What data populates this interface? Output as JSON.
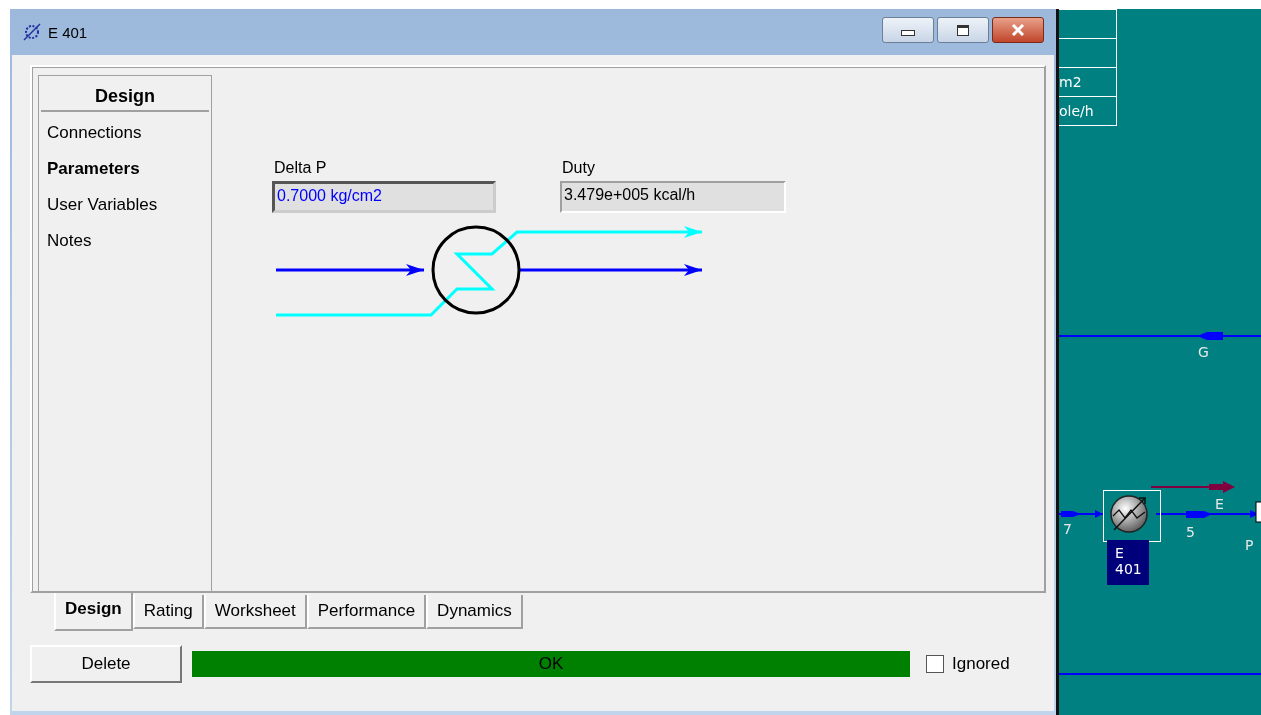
{
  "window": {
    "title": "E 401"
  },
  "sidebar": {
    "header": "Design",
    "items": [
      {
        "label": "Connections",
        "selected": false
      },
      {
        "label": "Parameters",
        "selected": true
      },
      {
        "label": "User Variables",
        "selected": false
      },
      {
        "label": "Notes",
        "selected": false
      }
    ]
  },
  "parameters": [
    {
      "label": "Delta P",
      "value": "0.7000 kg/cm2",
      "kind": "specified"
    },
    {
      "label": "Duty",
      "value": "3.479e+005 kcal/h",
      "kind": "calculated"
    }
  ],
  "tabs": [
    {
      "label": "Design",
      "selected": true
    },
    {
      "label": "Rating",
      "selected": false
    },
    {
      "label": "Worksheet",
      "selected": false
    },
    {
      "label": "Performance",
      "selected": false
    },
    {
      "label": "Dynamics",
      "selected": false
    }
  ],
  "delete_button": "Delete",
  "status": "OK",
  "ignored": {
    "label": "Ignored",
    "checked": false
  },
  "flowsheet": {
    "table_cells": [
      "m2",
      "ole/h"
    ],
    "stream_labels": [
      "G",
      "7",
      "5",
      "E",
      "P"
    ],
    "unit_label": "E 401"
  }
}
